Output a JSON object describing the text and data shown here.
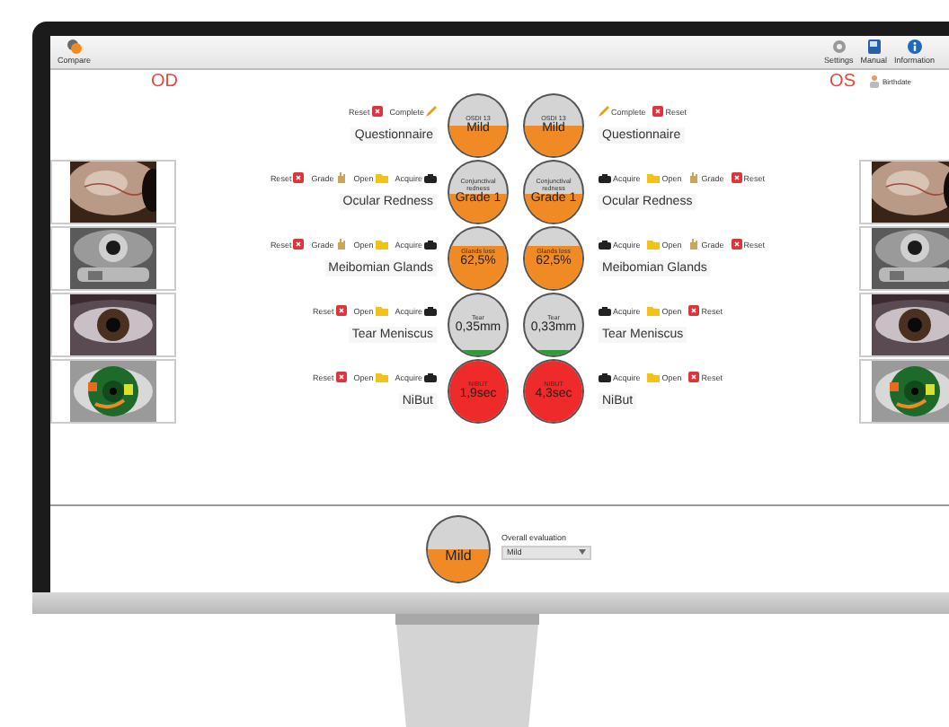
{
  "toolbar": {
    "left_buttons": [
      {
        "label": "Compare"
      }
    ],
    "right_buttons": [
      {
        "label": "Settings"
      },
      {
        "label": "Manual"
      },
      {
        "label": "Information"
      }
    ]
  },
  "patient": {
    "birthdate_label": "Birthdate"
  },
  "eyes": {
    "left": "OD",
    "right": "OS"
  },
  "rows": [
    {
      "od_name": "Questionnaire",
      "os_name": "Questionnaire",
      "has_images": false,
      "od": {
        "actions": [
          {
            "kind": "reset",
            "label": "Reset"
          },
          {
            "kind": "complete",
            "label": "Complete"
          }
        ],
        "gauge": {
          "caption": "OSDI 13",
          "value": "Mild",
          "level": 0.5,
          "color": "#f08a24"
        }
      },
      "os": {
        "actions": [
          {
            "kind": "complete",
            "label": "Complete"
          },
          {
            "kind": "reset",
            "label": "Reset"
          }
        ],
        "gauge": {
          "caption": "OSDI 13",
          "value": "Mild",
          "level": 0.5,
          "color": "#f08a24"
        }
      }
    },
    {
      "od_name": "Ocular Redness",
      "os_name": "Ocular Redness",
      "has_images": true,
      "od": {
        "actions": [
          {
            "kind": "reset",
            "label": "Reset"
          },
          {
            "kind": "grade",
            "label": "Grade"
          },
          {
            "kind": "open",
            "label": "Open"
          },
          {
            "kind": "acquire",
            "label": "Acquire"
          }
        ],
        "gauge": {
          "caption": "Conjunctival redness",
          "value": "Grade 1",
          "level": 0.45,
          "color": "#f08a24"
        }
      },
      "os": {
        "actions": [
          {
            "kind": "acquire",
            "label": "Acquire"
          },
          {
            "kind": "open",
            "label": "Open"
          },
          {
            "kind": "grade",
            "label": "Grade"
          },
          {
            "kind": "reset",
            "label": "Reset"
          }
        ],
        "gauge": {
          "caption": "Conjunctival redness",
          "value": "Grade 1",
          "level": 0.45,
          "color": "#f08a24"
        }
      }
    },
    {
      "od_name": "Meibomian Glands",
      "os_name": "Meibomian Glands",
      "has_images": true,
      "od": {
        "actions": [
          {
            "kind": "reset",
            "label": "Reset"
          },
          {
            "kind": "grade",
            "label": "Grade"
          },
          {
            "kind": "open",
            "label": "Open"
          },
          {
            "kind": "acquire",
            "label": "Acquire"
          }
        ],
        "gauge": {
          "caption": "Glands loss",
          "value": "62,5%",
          "level": 0.7,
          "color": "#f08a24"
        }
      },
      "os": {
        "actions": [
          {
            "kind": "acquire",
            "label": "Acquire"
          },
          {
            "kind": "open",
            "label": "Open"
          },
          {
            "kind": "grade",
            "label": "Grade"
          },
          {
            "kind": "reset",
            "label": "Reset"
          }
        ],
        "gauge": {
          "caption": "Glands loss",
          "value": "62,5%",
          "level": 0.7,
          "color": "#f08a24"
        }
      }
    },
    {
      "od_name": "Tear Meniscus",
      "os_name": "Tear Meniscus",
      "has_images": true,
      "od": {
        "actions": [
          {
            "kind": "reset",
            "label": "Reset"
          },
          {
            "kind": "open",
            "label": "Open"
          },
          {
            "kind": "acquire",
            "label": "Acquire"
          }
        ],
        "gauge": {
          "caption": "Tear",
          "value": "0,35mm",
          "level": 0.08,
          "color": "#2e9a3a"
        }
      },
      "os": {
        "actions": [
          {
            "kind": "acquire",
            "label": "Acquire"
          },
          {
            "kind": "open",
            "label": "Open"
          },
          {
            "kind": "reset",
            "label": "Reset"
          }
        ],
        "gauge": {
          "caption": "Tear",
          "value": "0,33mm",
          "level": 0.08,
          "color": "#2e9a3a"
        }
      }
    },
    {
      "od_name": "NiBut",
      "os_name": "NiBut",
      "has_images": true,
      "od": {
        "actions": [
          {
            "kind": "reset",
            "label": "Reset"
          },
          {
            "kind": "open",
            "label": "Open"
          },
          {
            "kind": "acquire",
            "label": "Acquire"
          }
        ],
        "gauge": {
          "caption": "NIBUT",
          "value": "1,9sec",
          "level": 1,
          "color": "#ee2a2a"
        }
      },
      "os": {
        "actions": [
          {
            "kind": "acquire",
            "label": "Acquire"
          },
          {
            "kind": "open",
            "label": "Open"
          },
          {
            "kind": "reset",
            "label": "Reset"
          }
        ],
        "gauge": {
          "caption": "NIBUT",
          "value": "4,3sec",
          "level": 1,
          "color": "#ee2a2a"
        }
      }
    }
  ],
  "overall": {
    "gauge": {
      "value": "Mild",
      "level": 0.5,
      "color": "#f08a24"
    },
    "label": "Overall evaluation",
    "select_value": "Mild"
  }
}
